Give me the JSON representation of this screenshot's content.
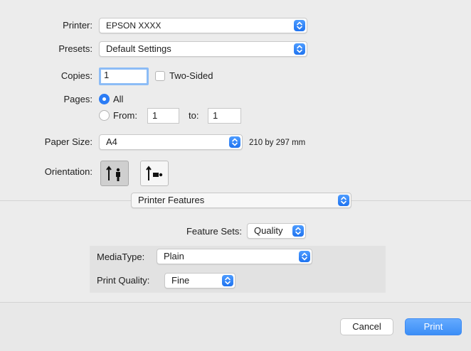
{
  "printer": {
    "label": "Printer:",
    "value": "EPSON XXXX"
  },
  "presets": {
    "label": "Presets:",
    "value": "Default Settings"
  },
  "copies": {
    "label": "Copies:",
    "value": "1",
    "two_sided_label": "Two-Sided",
    "two_sided_checked": false
  },
  "pages": {
    "label": "Pages:",
    "all_label": "All",
    "from_label": "From:",
    "from_value": "1",
    "to_label": "to:",
    "to_value": "1",
    "selected": "All"
  },
  "paper_size": {
    "label": "Paper Size:",
    "value": "A4",
    "dimensions": "210 by 297 mm"
  },
  "orientation": {
    "label": "Orientation:",
    "options": [
      "portrait-icon",
      "landscape-icon"
    ],
    "selected": "portrait"
  },
  "section": {
    "value": "Printer Features"
  },
  "feature_sets": {
    "label": "Feature Sets:",
    "value": "Quality"
  },
  "media_type": {
    "label": "MediaType:",
    "value": "Plain"
  },
  "print_quality": {
    "label": "Print Quality:",
    "value": "Fine"
  },
  "buttons": {
    "cancel": "Cancel",
    "print": "Print"
  },
  "colors": {
    "accent": "#2b7cf5",
    "background": "#ececec",
    "panel": "#e2e2e2"
  }
}
